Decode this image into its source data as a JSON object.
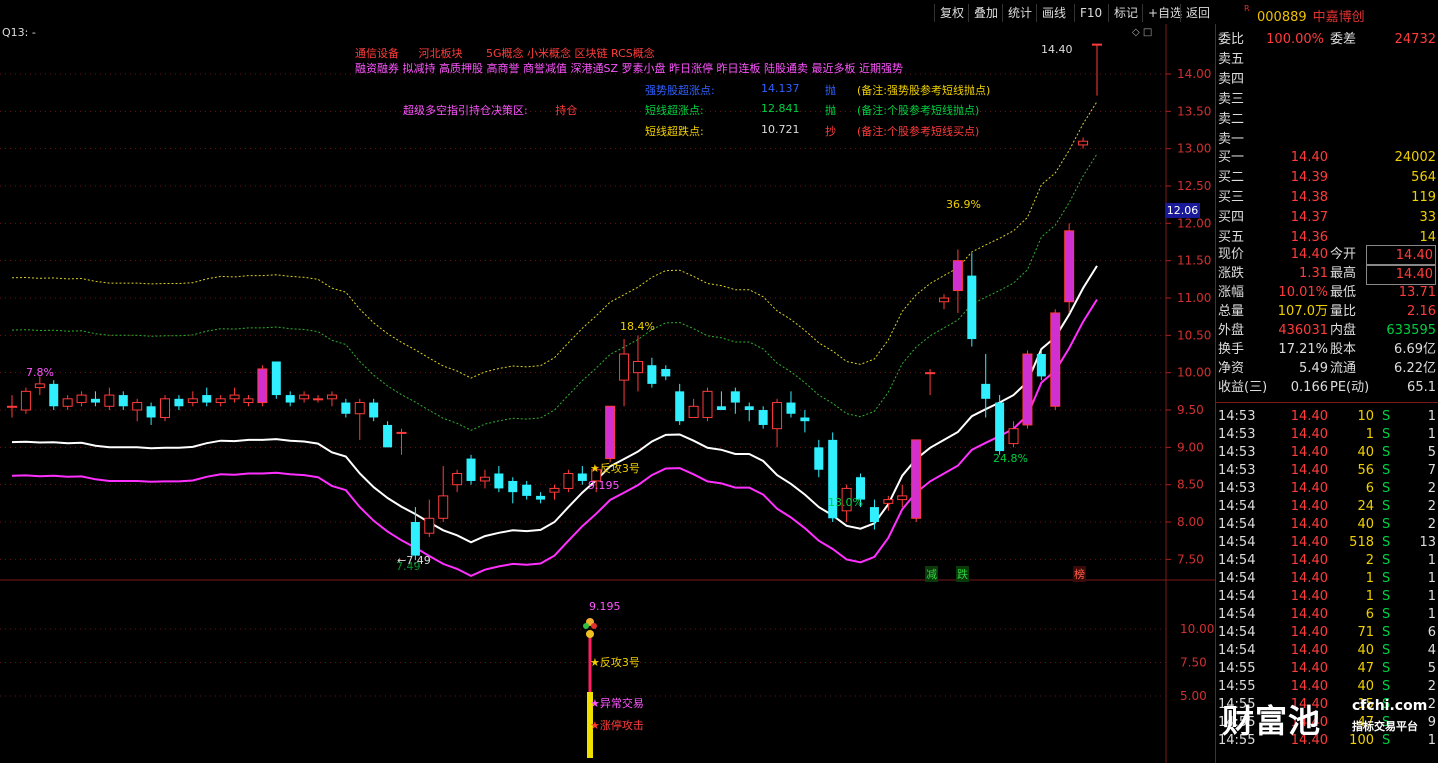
{
  "toolbar": {
    "buttons": [
      "复权",
      "叠加",
      "统计",
      "画线",
      "F10",
      "标记",
      "+自选",
      "返回"
    ]
  },
  "stock": {
    "code": "000889",
    "name": "中嘉博创",
    "r_mark": "R"
  },
  "chart": {
    "indicator_label": "Q13: -",
    "concepts_line1": [
      "通信设备",
      "河北板块",
      "5G概念",
      "小米概念",
      "区块链",
      "RCS概念"
    ],
    "concepts_line2": "融资融券 拟减持 高质押股 高商誉 商誉减值 深港通SZ 罗素小盘 昨日涨停 昨日连板 陆股通卖 最近多板 近期强势",
    "strong_label": "强势股超涨点:",
    "strong_value": "14.137",
    "strong_action": "抛",
    "strong_note": "(备注:强势股参考短线抛点)",
    "short_label": "短线超涨点:",
    "short_value": "12.841",
    "short_action": "抛",
    "short_note": "(备注:个股参考短线抛点)",
    "dip_label": "短线超跌点:",
    "dip_value": "10.721",
    "dip_action": "抄",
    "dip_note": "(备注:个股参考短线买点)",
    "strategy_label": "超级多空指引持仓决策区:",
    "strategy_value": "持仓",
    "y_ticks": [
      "14.00",
      "13.50",
      "13.00",
      "12.50",
      "12.00",
      "11.50",
      "11.00",
      "10.50",
      "10.00",
      "9.50",
      "9.00",
      "8.50",
      "8.00",
      "7.50"
    ],
    "current_price_tag": "12.06",
    "annotations": {
      "high_arrow": "14.40",
      "low_arrow": "7.49",
      "low_label": "7.49",
      "pct_a": "7.8%",
      "pct_b": "18.4%",
      "pct_c": "36.9%",
      "pct_d": "24.8%",
      "pct_e": "13.0%",
      "signal_star": "★反攻3号",
      "signal_price": "9.195"
    },
    "bottom_markers": [
      "减",
      "跌",
      "榜"
    ],
    "sub_y_ticks": [
      "10.00",
      "7.50",
      "5.00"
    ],
    "sub_labels": {
      "price": "9.195",
      "signal1": "★反攻3号",
      "signal2": "★异常交易",
      "signal3": "★涨停攻击"
    }
  },
  "quote": {
    "commission_ratio_label": "委比",
    "commission_ratio": "100.00%",
    "commission_diff_label": "委差",
    "commission_diff": "24732",
    "sells": [
      {
        "label": "卖五"
      },
      {
        "label": "卖四"
      },
      {
        "label": "卖三"
      },
      {
        "label": "卖二"
      },
      {
        "label": "卖一"
      }
    ],
    "buys": [
      {
        "label": "买一",
        "price": "14.40",
        "vol": "24002"
      },
      {
        "label": "买二",
        "price": "14.39",
        "vol": "564"
      },
      {
        "label": "买三",
        "price": "14.38",
        "vol": "119"
      },
      {
        "label": "买四",
        "price": "14.37",
        "vol": "33"
      },
      {
        "label": "买五",
        "price": "14.36",
        "vol": "14"
      }
    ],
    "stats": [
      {
        "l1": "现价",
        "v1": "14.40",
        "l2": "今开",
        "v2": "14.40",
        "c1": "r",
        "c2": "r",
        "box": true
      },
      {
        "l1": "涨跌",
        "v1": "1.31",
        "l2": "最高",
        "v2": "14.40",
        "c1": "r",
        "c2": "r",
        "box": true
      },
      {
        "l1": "涨幅",
        "v1": "10.01%",
        "l2": "最低",
        "v2": "13.71",
        "c1": "r",
        "c2": "r"
      },
      {
        "l1": "总量",
        "v1": "107.0万",
        "l2": "量比",
        "v2": "2.16",
        "c1": "y",
        "c2": "r"
      },
      {
        "l1": "外盘",
        "v1": "436031",
        "l2": "内盘",
        "v2": "633595",
        "c1": "r",
        "c2": "g"
      },
      {
        "l1": "换手",
        "v1": "17.21%",
        "l2": "股本",
        "v2": "6.69亿",
        "c1": "w",
        "c2": "w"
      },
      {
        "l1": "净资",
        "v1": "5.49",
        "l2": "流通",
        "v2": "6.22亿",
        "c1": "w",
        "c2": "w"
      },
      {
        "l1": "收益(三)",
        "v1": "0.166",
        "l2": "PE(动)",
        "v2": "65.1",
        "c1": "w",
        "c2": "w"
      }
    ],
    "ticks": [
      {
        "t": "14:53",
        "p": "14.40",
        "v": "10",
        "s": "S",
        "n": "1"
      },
      {
        "t": "14:53",
        "p": "14.40",
        "v": "1",
        "s": "S",
        "n": "1"
      },
      {
        "t": "14:53",
        "p": "14.40",
        "v": "40",
        "s": "S",
        "n": "5"
      },
      {
        "t": "14:53",
        "p": "14.40",
        "v": "56",
        "s": "S",
        "n": "7"
      },
      {
        "t": "14:53",
        "p": "14.40",
        "v": "6",
        "s": "S",
        "n": "2"
      },
      {
        "t": "14:54",
        "p": "14.40",
        "v": "24",
        "s": "S",
        "n": "2"
      },
      {
        "t": "14:54",
        "p": "14.40",
        "v": "40",
        "s": "S",
        "n": "2"
      },
      {
        "t": "14:54",
        "p": "14.40",
        "v": "518",
        "s": "S",
        "n": "13"
      },
      {
        "t": "14:54",
        "p": "14.40",
        "v": "2",
        "s": "S",
        "n": "1"
      },
      {
        "t": "14:54",
        "p": "14.40",
        "v": "1",
        "s": "S",
        "n": "1"
      },
      {
        "t": "14:54",
        "p": "14.40",
        "v": "1",
        "s": "S",
        "n": "1"
      },
      {
        "t": "14:54",
        "p": "14.40",
        "v": "6",
        "s": "S",
        "n": "1"
      },
      {
        "t": "14:54",
        "p": "14.40",
        "v": "71",
        "s": "S",
        "n": "6"
      },
      {
        "t": "14:54",
        "p": "14.40",
        "v": "40",
        "s": "S",
        "n": "4"
      },
      {
        "t": "14:55",
        "p": "14.40",
        "v": "47",
        "s": "S",
        "n": "5"
      },
      {
        "t": "14:55",
        "p": "14.40",
        "v": "40",
        "s": "S",
        "n": "2"
      },
      {
        "t": "14:55",
        "p": "14.40",
        "v": "15",
        "s": "S",
        "n": "2"
      },
      {
        "t": "14:55",
        "p": "14.40",
        "v": "47",
        "s": "S",
        "n": "9"
      },
      {
        "t": "14:55",
        "p": "14.40",
        "v": "100",
        "s": "S",
        "n": "1"
      }
    ]
  },
  "watermark": {
    "brand": "财富池",
    "site": "cfchi.com",
    "slogan": "指标交易平台"
  },
  "candles": [
    {
      "o": 9.55,
      "c": 9.55,
      "h": 9.7,
      "l": 9.4
    },
    {
      "o": 9.5,
      "c": 9.75,
      "h": 9.8,
      "l": 9.45
    },
    {
      "o": 9.8,
      "c": 9.85,
      "h": 9.95,
      "l": 9.7
    },
    {
      "o": 9.85,
      "c": 9.55,
      "h": 9.9,
      "l": 9.5
    },
    {
      "o": 9.55,
      "c": 9.65,
      "h": 9.7,
      "l": 9.5
    },
    {
      "o": 9.6,
      "c": 9.7,
      "h": 9.75,
      "l": 9.55
    },
    {
      "o": 9.65,
      "c": 9.6,
      "h": 9.75,
      "l": 9.55
    },
    {
      "o": 9.55,
      "c": 9.7,
      "h": 9.8,
      "l": 9.5
    },
    {
      "o": 9.7,
      "c": 9.55,
      "h": 9.75,
      "l": 9.5
    },
    {
      "o": 9.5,
      "c": 9.6,
      "h": 9.65,
      "l": 9.35
    },
    {
      "o": 9.55,
      "c": 9.4,
      "h": 9.6,
      "l": 9.3
    },
    {
      "o": 9.4,
      "c": 9.65,
      "h": 9.7,
      "l": 9.35
    },
    {
      "o": 9.65,
      "c": 9.55,
      "h": 9.7,
      "l": 9.5
    },
    {
      "o": 9.6,
      "c": 9.65,
      "h": 9.75,
      "l": 9.55
    },
    {
      "o": 9.7,
      "c": 9.6,
      "h": 9.8,
      "l": 9.55
    },
    {
      "o": 9.6,
      "c": 9.65,
      "h": 9.7,
      "l": 9.55
    },
    {
      "o": 9.65,
      "c": 9.7,
      "h": 9.8,
      "l": 9.6
    },
    {
      "o": 9.6,
      "c": 9.65,
      "h": 9.7,
      "l": 9.55
    },
    {
      "o": 9.6,
      "c": 10.05,
      "h": 10.1,
      "l": 9.55
    },
    {
      "o": 10.15,
      "c": 9.7,
      "h": 10.15,
      "l": 9.65
    },
    {
      "o": 9.7,
      "c": 9.6,
      "h": 9.75,
      "l": 9.55
    },
    {
      "o": 9.65,
      "c": 9.7,
      "h": 9.75,
      "l": 9.6
    },
    {
      "o": 9.65,
      "c": 9.65,
      "h": 9.7,
      "l": 9.6
    },
    {
      "o": 9.65,
      "c": 9.7,
      "h": 9.75,
      "l": 9.55
    },
    {
      "o": 9.6,
      "c": 9.45,
      "h": 9.65,
      "l": 9.4
    },
    {
      "o": 9.45,
      "c": 9.6,
      "h": 9.65,
      "l": 9.1
    },
    {
      "o": 9.6,
      "c": 9.4,
      "h": 9.65,
      "l": 9.35
    },
    {
      "o": 9.3,
      "c": 9.0,
      "h": 9.35,
      "l": 9.0
    },
    {
      "o": 9.2,
      "c": 9.2,
      "h": 9.25,
      "l": 8.9
    },
    {
      "o": 8.0,
      "c": 7.55,
      "h": 8.2,
      "l": 7.49
    },
    {
      "o": 7.85,
      "c": 8.05,
      "h": 8.3,
      "l": 7.8
    },
    {
      "o": 8.05,
      "c": 8.35,
      "h": 8.75,
      "l": 8.0
    },
    {
      "o": 8.5,
      "c": 8.65,
      "h": 8.7,
      "l": 8.4
    },
    {
      "o": 8.85,
      "c": 8.55,
      "h": 8.9,
      "l": 8.5
    },
    {
      "o": 8.55,
      "c": 8.6,
      "h": 8.7,
      "l": 8.45
    },
    {
      "o": 8.65,
      "c": 8.45,
      "h": 8.75,
      "l": 8.4
    },
    {
      "o": 8.55,
      "c": 8.4,
      "h": 8.6,
      "l": 8.25
    },
    {
      "o": 8.5,
      "c": 8.35,
      "h": 8.55,
      "l": 8.3
    },
    {
      "o": 8.35,
      "c": 8.3,
      "h": 8.4,
      "l": 8.25
    },
    {
      "o": 8.4,
      "c": 8.45,
      "h": 8.5,
      "l": 8.3
    },
    {
      "o": 8.45,
      "c": 8.65,
      "h": 8.7,
      "l": 8.4
    },
    {
      "o": 8.65,
      "c": 8.55,
      "h": 8.75,
      "l": 8.5
    },
    {
      "o": 8.55,
      "c": 8.7,
      "h": 8.75,
      "l": 8.4
    },
    {
      "o": 8.85,
      "c": 9.55,
      "h": 9.55,
      "l": 8.8
    },
    {
      "o": 9.9,
      "c": 10.25,
      "h": 10.45,
      "l": 9.55
    },
    {
      "o": 10.0,
      "c": 10.15,
      "h": 10.5,
      "l": 9.75
    },
    {
      "o": 10.1,
      "c": 9.85,
      "h": 10.2,
      "l": 9.8
    },
    {
      "o": 10.05,
      "c": 9.95,
      "h": 10.1,
      "l": 9.9
    },
    {
      "o": 9.75,
      "c": 9.35,
      "h": 9.85,
      "l": 9.3
    },
    {
      "o": 9.4,
      "c": 9.55,
      "h": 9.65,
      "l": 9.4
    },
    {
      "o": 9.4,
      "c": 9.75,
      "h": 9.8,
      "l": 9.35
    },
    {
      "o": 9.55,
      "c": 9.5,
      "h": 9.75,
      "l": 9.5
    },
    {
      "o": 9.75,
      "c": 9.6,
      "h": 9.8,
      "l": 9.45
    },
    {
      "o": 9.55,
      "c": 9.5,
      "h": 9.6,
      "l": 9.35
    },
    {
      "o": 9.5,
      "c": 9.3,
      "h": 9.55,
      "l": 9.25
    },
    {
      "o": 9.25,
      "c": 9.6,
      "h": 9.65,
      "l": 9.0
    },
    {
      "o": 9.6,
      "c": 9.45,
      "h": 9.75,
      "l": 9.4
    },
    {
      "o": 9.4,
      "c": 9.35,
      "h": 9.5,
      "l": 9.2
    },
    {
      "o": 9.0,
      "c": 8.7,
      "h": 9.1,
      "l": 8.6
    },
    {
      "o": 9.1,
      "c": 8.05,
      "h": 9.2,
      "l": 8.0
    },
    {
      "o": 8.15,
      "c": 8.45,
      "h": 8.5,
      "l": 8.0
    },
    {
      "o": 8.6,
      "c": 8.3,
      "h": 8.65,
      "l": 8.2
    },
    {
      "o": 8.2,
      "c": 8.0,
      "h": 8.3,
      "l": 7.9
    },
    {
      "o": 8.25,
      "c": 8.3,
      "h": 8.35,
      "l": 8.15
    },
    {
      "o": 8.3,
      "c": 8.35,
      "h": 8.5,
      "l": 8.2
    },
    {
      "o": 8.05,
      "c": 9.1,
      "h": 9.1,
      "l": 8.0
    },
    {
      "o": 10.0,
      "c": 10.0,
      "h": 10.05,
      "l": 9.7
    },
    {
      "o": 10.95,
      "c": 11.0,
      "h": 11.05,
      "l": 10.85
    },
    {
      "o": 11.1,
      "c": 11.5,
      "h": 11.65,
      "l": 10.8
    },
    {
      "o": 11.3,
      "c": 10.45,
      "h": 11.6,
      "l": 10.35
    },
    {
      "o": 9.85,
      "c": 9.65,
      "h": 10.25,
      "l": 9.4
    },
    {
      "o": 9.6,
      "c": 8.95,
      "h": 9.7,
      "l": 8.9
    },
    {
      "o": 9.05,
      "c": 9.25,
      "h": 9.35,
      "l": 9.0
    },
    {
      "o": 9.3,
      "c": 10.25,
      "h": 10.3,
      "l": 9.25
    },
    {
      "o": 10.25,
      "c": 9.95,
      "h": 10.3,
      "l": 9.9
    },
    {
      "o": 9.55,
      "c": 10.8,
      "h": 10.85,
      "l": 9.5
    },
    {
      "o": 10.95,
      "c": 11.9,
      "h": 12.0,
      "l": 10.8
    },
    {
      "o": 13.05,
      "c": 13.1,
      "h": 13.15,
      "l": 13.0
    },
    {
      "o": 14.4,
      "c": 14.4,
      "h": 14.4,
      "l": 13.71
    }
  ]
}
